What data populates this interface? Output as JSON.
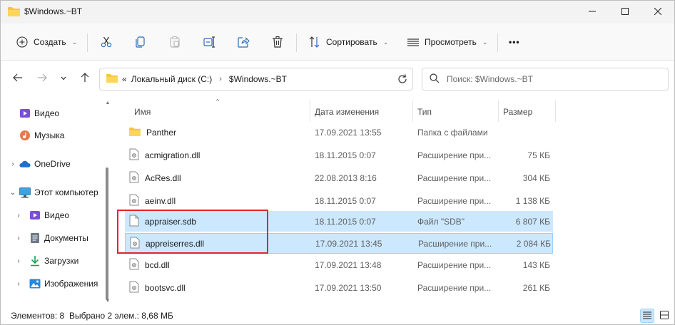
{
  "window": {
    "title": "$Windows.~BT",
    "minimize_icon": "minimize-icon",
    "maximize_icon": "maximize-icon",
    "close_icon": "close-icon"
  },
  "toolbar": {
    "new_label": "Создать",
    "sort_label": "Сортировать",
    "view_label": "Просмотреть",
    "more_label": "•••",
    "icons": [
      "cut-icon",
      "copy-icon",
      "paste-icon",
      "rename-icon",
      "share-icon",
      "delete-icon"
    ]
  },
  "navigation": {
    "address_parts": [
      "«",
      "Локальный диск (C:)",
      "$Windows.~BT"
    ],
    "search_placeholder": "Поиск: $Windows.~BT"
  },
  "nav_pane": {
    "items": [
      {
        "label": "Видео",
        "icon": "video-icon",
        "indent": 1,
        "chevron": ""
      },
      {
        "label": "Музыка",
        "icon": "music-icon",
        "indent": 1,
        "chevron": ""
      },
      {
        "label": "OneDrive",
        "icon": "onedrive-icon",
        "indent": 0,
        "chevron": "›"
      },
      {
        "label": "Этот компьютер",
        "icon": "this-pc-icon",
        "indent": 0,
        "chevron": "⌄"
      },
      {
        "label": "Видео",
        "icon": "video-icon",
        "indent": 1,
        "chevron": "›"
      },
      {
        "label": "Документы",
        "icon": "documents-icon",
        "indent": 1,
        "chevron": "›"
      },
      {
        "label": "Загрузки",
        "icon": "downloads-icon",
        "indent": 1,
        "chevron": "›"
      },
      {
        "label": "Изображения",
        "icon": "pictures-icon",
        "indent": 1,
        "chevron": "›"
      }
    ]
  },
  "file_list": {
    "columns": {
      "name": "Имя",
      "date": "Дата изменения",
      "type": "Тип",
      "size": "Размер"
    },
    "rows": [
      {
        "name": "Panther",
        "date": "17.09.2021 13:55",
        "type": "Папка с файлами",
        "size": "",
        "icon": "folder-icon",
        "selected": false
      },
      {
        "name": "acmigration.dll",
        "date": "18.11.2015 0:07",
        "type": "Расширение при...",
        "size": "75 КБ",
        "icon": "dll-file-icon",
        "selected": false
      },
      {
        "name": "AcRes.dll",
        "date": "22.08.2013 8:16",
        "type": "Расширение при...",
        "size": "304 КБ",
        "icon": "dll-file-icon",
        "selected": false
      },
      {
        "name": "aeinv.dll",
        "date": "18.11.2015 0:07",
        "type": "Расширение при...",
        "size": "1 138 КБ",
        "icon": "dll-file-icon",
        "selected": false
      },
      {
        "name": "appraiser.sdb",
        "date": "18.11.2015 0:07",
        "type": "Файл \"SDB\"",
        "size": "6 807 КБ",
        "icon": "file-icon",
        "selected": true
      },
      {
        "name": "appreiserres.dll",
        "date": "17.09.2021 13:45",
        "type": "Расширение при...",
        "size": "2 084 КБ",
        "icon": "dll-file-icon",
        "selected": true
      },
      {
        "name": "bcd.dll",
        "date": "17.09.2021 13:48",
        "type": "Расширение при...",
        "size": "143 КБ",
        "icon": "dll-file-icon",
        "selected": false
      },
      {
        "name": "bootsvc.dll",
        "date": "17.09.2021 13:50",
        "type": "Расширение при...",
        "size": "261 КБ",
        "icon": "dll-file-icon",
        "selected": false
      }
    ]
  },
  "status": {
    "items_count": "Элементов: 8",
    "selection": "Выбрано 2 элем.: 8,68 МБ"
  },
  "colors": {
    "selection": "#cce8ff",
    "selection_border": "#99d1ff",
    "highlight_box": "#e0262b",
    "folder": "#f8c53a"
  }
}
